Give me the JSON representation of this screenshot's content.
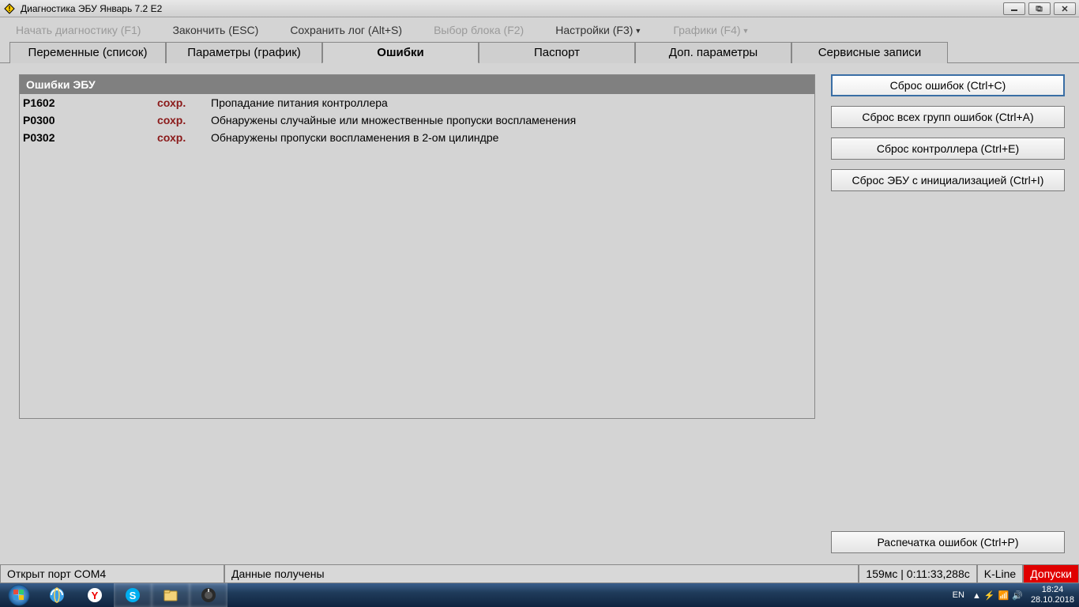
{
  "window": {
    "title": "Диагностика ЭБУ Январь 7.2 E2"
  },
  "menu": {
    "start_diag": "Начать диагностику (F1)",
    "finish": "Закончить (ESC)",
    "save_log": "Сохранить лог (Alt+S)",
    "block_select": "Выбор блока (F2)",
    "settings": "Настройки (F3)",
    "charts": "Графики (F4)"
  },
  "tabs": {
    "variables": "Переменные (список)",
    "params": "Параметры (график)",
    "errors": "Ошибки",
    "passport": "Паспорт",
    "extra": "Доп. параметры",
    "service": "Сервисные записи"
  },
  "panel": {
    "header": "Ошибки ЭБУ"
  },
  "errors": [
    {
      "code": "P1602",
      "status": "сохр.",
      "desc": "Пропадание питания контроллера"
    },
    {
      "code": "P0300",
      "status": "сохр.",
      "desc": "Обнаружены случайные или множественные пропуски воспламенения"
    },
    {
      "code": "P0302",
      "status": "сохр.",
      "desc": "Обнаружены пропуски воспламенения в 2-ом цилиндре"
    }
  ],
  "buttons": {
    "clear_errors": "Сброс ошибок (Ctrl+C)",
    "clear_all_groups": "Сброс всех групп ошибок (Ctrl+A)",
    "reset_controller": "Сброс контроллера (Ctrl+E)",
    "reset_ecu_init": "Сброс ЭБУ с инициализацией (Ctrl+I)",
    "print_errors": "Распечатка ошибок (Ctrl+P)"
  },
  "status": {
    "port": "Открыт порт COM4",
    "msg": "Данные получены",
    "timing": "159мс | 0:11:33,288с",
    "kline": "K-Line",
    "dopusk": "Допуски"
  },
  "taskbar": {
    "lang": "EN",
    "time": "18:24",
    "date": "28.10.2018"
  }
}
